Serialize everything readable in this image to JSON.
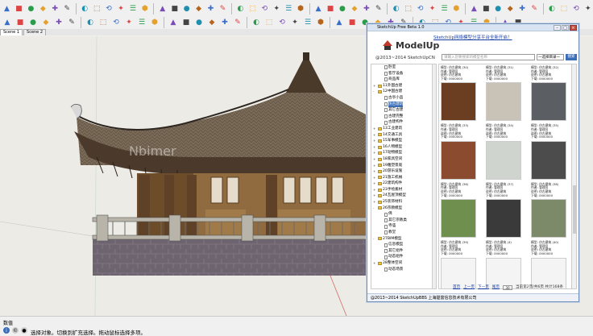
{
  "tabs": [
    "Scene 1",
    "Scene 2"
  ],
  "toolbar_icons": [
    "select-icon",
    "eraser-icon",
    "pencil-icon",
    "line-icon",
    "arc-icon",
    "rectangle-icon",
    "circle-icon",
    "polygon-icon",
    "push-pull-icon",
    "move-icon",
    "rotate-icon",
    "offset-icon",
    "scale-icon",
    "tape-icon",
    "dimension-icon",
    "protractor-icon",
    "text-icon",
    "axes-icon",
    "paint-icon",
    "orbit-icon",
    "pan-icon",
    "zoom-icon",
    "zoom-window-icon",
    "zoom-extents-icon",
    "previous-view-icon",
    "play-icon",
    "pause-icon",
    "stop-icon",
    "section-icon",
    "component-icon",
    "group-icon",
    "layers-icon",
    "materials-icon",
    "styles-icon",
    "shadows-icon",
    "fog-icon",
    "scenes-icon",
    "outliner-icon",
    "ruby-icon",
    "warehouse-icon",
    "plugin-icon",
    "export-icon",
    "geo-icon",
    "extension-icon",
    "sandbox-icon",
    "solid-icon"
  ],
  "toolbar2_icons": [
    "house-icon",
    "iso-icon",
    "top-view-icon",
    "front-view-icon",
    "right-view-icon",
    "back-view-icon",
    "left-view-icon",
    "xray-icon",
    "back-edges-icon",
    "wireframe-icon",
    "hidden-line-icon",
    "shaded-icon",
    "textured-icon",
    "monochrome-icon",
    "follow-me-icon",
    "intersect-icon",
    "union-icon",
    "subtract-icon",
    "trim-icon",
    "split-icon",
    "outer-shell-icon",
    "walk-icon",
    "look-around-icon",
    "position-camera-icon",
    "field-of-view-icon",
    "add-location-icon",
    "toggle-terrain-icon",
    "preview-icon",
    "upload-icon",
    "download-icon",
    "share-icon",
    "model-info-icon",
    "entity-info-icon",
    "instructor-icon",
    "fonts-icon",
    "match-photo-icon",
    "soften-edges-icon",
    "photo-textures-icon"
  ],
  "watermark": "Nbimer",
  "status": {
    "mode": "数值",
    "hint": "选择对象。切换到扩充选择。拖动鼠标选择多项。"
  },
  "plugin": {
    "title": "SketchUp Free Beta 1.0",
    "logo": "ModelUp",
    "copyright_top": "@2013~2014 SketchUpCN",
    "ad_link": "SketchUp网络模型分享平台全新开启！",
    "search_placeholder": "请输入您要搜索的模型名称",
    "category": "一选择目录一",
    "search_button": "搜索",
    "tree": [
      {
        "exp": "",
        "type": "page",
        "label": "卧室",
        "indent": 2
      },
      {
        "exp": "",
        "type": "page",
        "label": "客厅设备",
        "indent": 2
      },
      {
        "exp": "",
        "type": "page",
        "label": "商品库",
        "indent": 2
      },
      {
        "exp": "+",
        "type": "fold",
        "label": "11外国古建",
        "indent": 0
      },
      {
        "exp": "-",
        "type": "fold",
        "label": "12中国古建",
        "indent": 0
      },
      {
        "exp": "",
        "type": "page",
        "label": "古亭小品",
        "indent": 2
      },
      {
        "exp": "",
        "type": "page",
        "label": "仿古建筑",
        "indent": 2,
        "sel": true
      },
      {
        "exp": "",
        "type": "page",
        "label": "其它古建",
        "indent": 2
      },
      {
        "exp": "",
        "type": "page",
        "label": "古建完整",
        "indent": 2
      },
      {
        "exp": "",
        "type": "page",
        "label": "古建构件",
        "indent": 2
      },
      {
        "exp": "+",
        "type": "fold",
        "label": "13工业建筑",
        "indent": 0
      },
      {
        "exp": "+",
        "type": "fold",
        "label": "14交通工具",
        "indent": 0
      },
      {
        "exp": "+",
        "type": "fold",
        "label": "15军事模型",
        "indent": 0
      },
      {
        "exp": "+",
        "type": "fold",
        "label": "16人物模型",
        "indent": 0
      },
      {
        "exp": "+",
        "type": "fold",
        "label": "17动物模型",
        "indent": 0
      },
      {
        "exp": "+",
        "type": "fold",
        "label": "18家具空间",
        "indent": 0
      },
      {
        "exp": "+",
        "type": "fold",
        "label": "19雕塑景观",
        "indent": 0
      },
      {
        "exp": "+",
        "type": "fold",
        "label": "20游乐设施",
        "indent": 0
      },
      {
        "exp": "+",
        "type": "fold",
        "label": "21施工机械",
        "indent": 0
      },
      {
        "exp": "+",
        "type": "fold",
        "label": "22建筑构件",
        "indent": 0
      },
      {
        "exp": "+",
        "type": "fold",
        "label": "23手绘素材",
        "indent": 0
      },
      {
        "exp": "+",
        "type": "fold",
        "label": "24瓦屋顶模型",
        "indent": 0
      },
      {
        "exp": "+",
        "type": "fold",
        "label": "25装饰材料",
        "indent": 0
      },
      {
        "exp": "-",
        "type": "fold",
        "label": "26宗教模型",
        "indent": 0
      },
      {
        "exp": "",
        "type": "page",
        "label": "佛",
        "indent": 2
      },
      {
        "exp": "",
        "type": "page",
        "label": "其它宗教类",
        "indent": 2
      },
      {
        "exp": "",
        "type": "page",
        "label": "寺庙",
        "indent": 2
      },
      {
        "exp": "",
        "type": "page",
        "label": "教堂",
        "indent": 2
      },
      {
        "exp": "-",
        "type": "fold",
        "label": "27BIM模型",
        "indent": 0
      },
      {
        "exp": "",
        "type": "page",
        "label": "信息模型",
        "indent": 2
      },
      {
        "exp": "",
        "type": "page",
        "label": "其它组件",
        "indent": 2
      },
      {
        "exp": "",
        "type": "page",
        "label": "动态组件",
        "indent": 2
      },
      {
        "exp": "+",
        "type": "fold",
        "label": "28整体空间",
        "indent": 0
      },
      {
        "exp": "",
        "type": "page",
        "label": "动态场景",
        "indent": 2
      }
    ],
    "cells": [
      {
        "n": "模型: 仿古建筑 (30)",
        "a": "作者: 管理员",
        "d": "说明: 仿古建筑",
        "c": "下载: 0000000",
        "th": "tile-brown"
      },
      {
        "n": "模型: 仿古建筑 (31)",
        "a": "作者: 管理员",
        "d": "说明: 仿古建筑",
        "c": "下载: 0000000",
        "th": "tile-roof"
      },
      {
        "n": "模型: 仿古建筑 (32)",
        "a": "作者: 管理员",
        "d": "说明: 仿古建筑",
        "c": "下载: 0000000",
        "th": "tile-gray"
      },
      {
        "n": "模型: 仿古建筑 (33)",
        "a": "作者: 管理员",
        "d": "说明: 仿古建筑",
        "c": "下载: 0000000",
        "th": "tile-tower"
      },
      {
        "n": "模型: 仿古建筑 (34)",
        "a": "作者: 管理员",
        "d": "说明: 仿古建筑",
        "c": "下载: 0000000",
        "th": "tile-plan"
      },
      {
        "n": "模型: 仿古建筑 (35)",
        "a": "作者: 管理员",
        "d": "说明: 仿古建筑",
        "c": "下载: 0000000",
        "th": "tile-court"
      },
      {
        "n": "模型: 仿古建筑 (36)",
        "a": "作者: 管理员",
        "d": "说明: 仿古建筑",
        "c": "下载: 0000000",
        "th": "tile-green"
      },
      {
        "n": "模型: 仿古建筑 (37)",
        "a": "作者: 管理员",
        "d": "说明: 仿古建筑",
        "c": "下载: 0000000",
        "th": "tile-dark"
      },
      {
        "n": "模型: 仿古建筑 (38)",
        "a": "作者: 管理员",
        "d": "说明: 仿古建筑",
        "c": "下载: 0000000",
        "th": "tile-iso"
      },
      {
        "n": "模型: 仿古建筑 (39)",
        "a": "作者: 管理员",
        "d": "说明: 仿古建筑",
        "c": "下载: 0000000",
        "th": "tile-blank"
      },
      {
        "n": "模型: 仿古建筑 (4)",
        "a": "作者: 管理员",
        "d": "说明: 仿古建筑",
        "c": "下载: 0000000",
        "th": "tile-blank"
      },
      {
        "n": "模型: 仿古建筑 (40)",
        "a": "作者: 管理员",
        "d": "说明: 仿古建筑",
        "c": "下载: 0000000",
        "th": "tile-blank"
      }
    ],
    "pager": {
      "first": "首页",
      "prev": "上一页",
      "next": "下一页",
      "last": "尾页",
      "page_value": "30",
      "info": "当前第2页/共6页 共计168条"
    },
    "footer": "@2013~2014 SketchUpBBS 上海楚富信息技术有限公司"
  }
}
